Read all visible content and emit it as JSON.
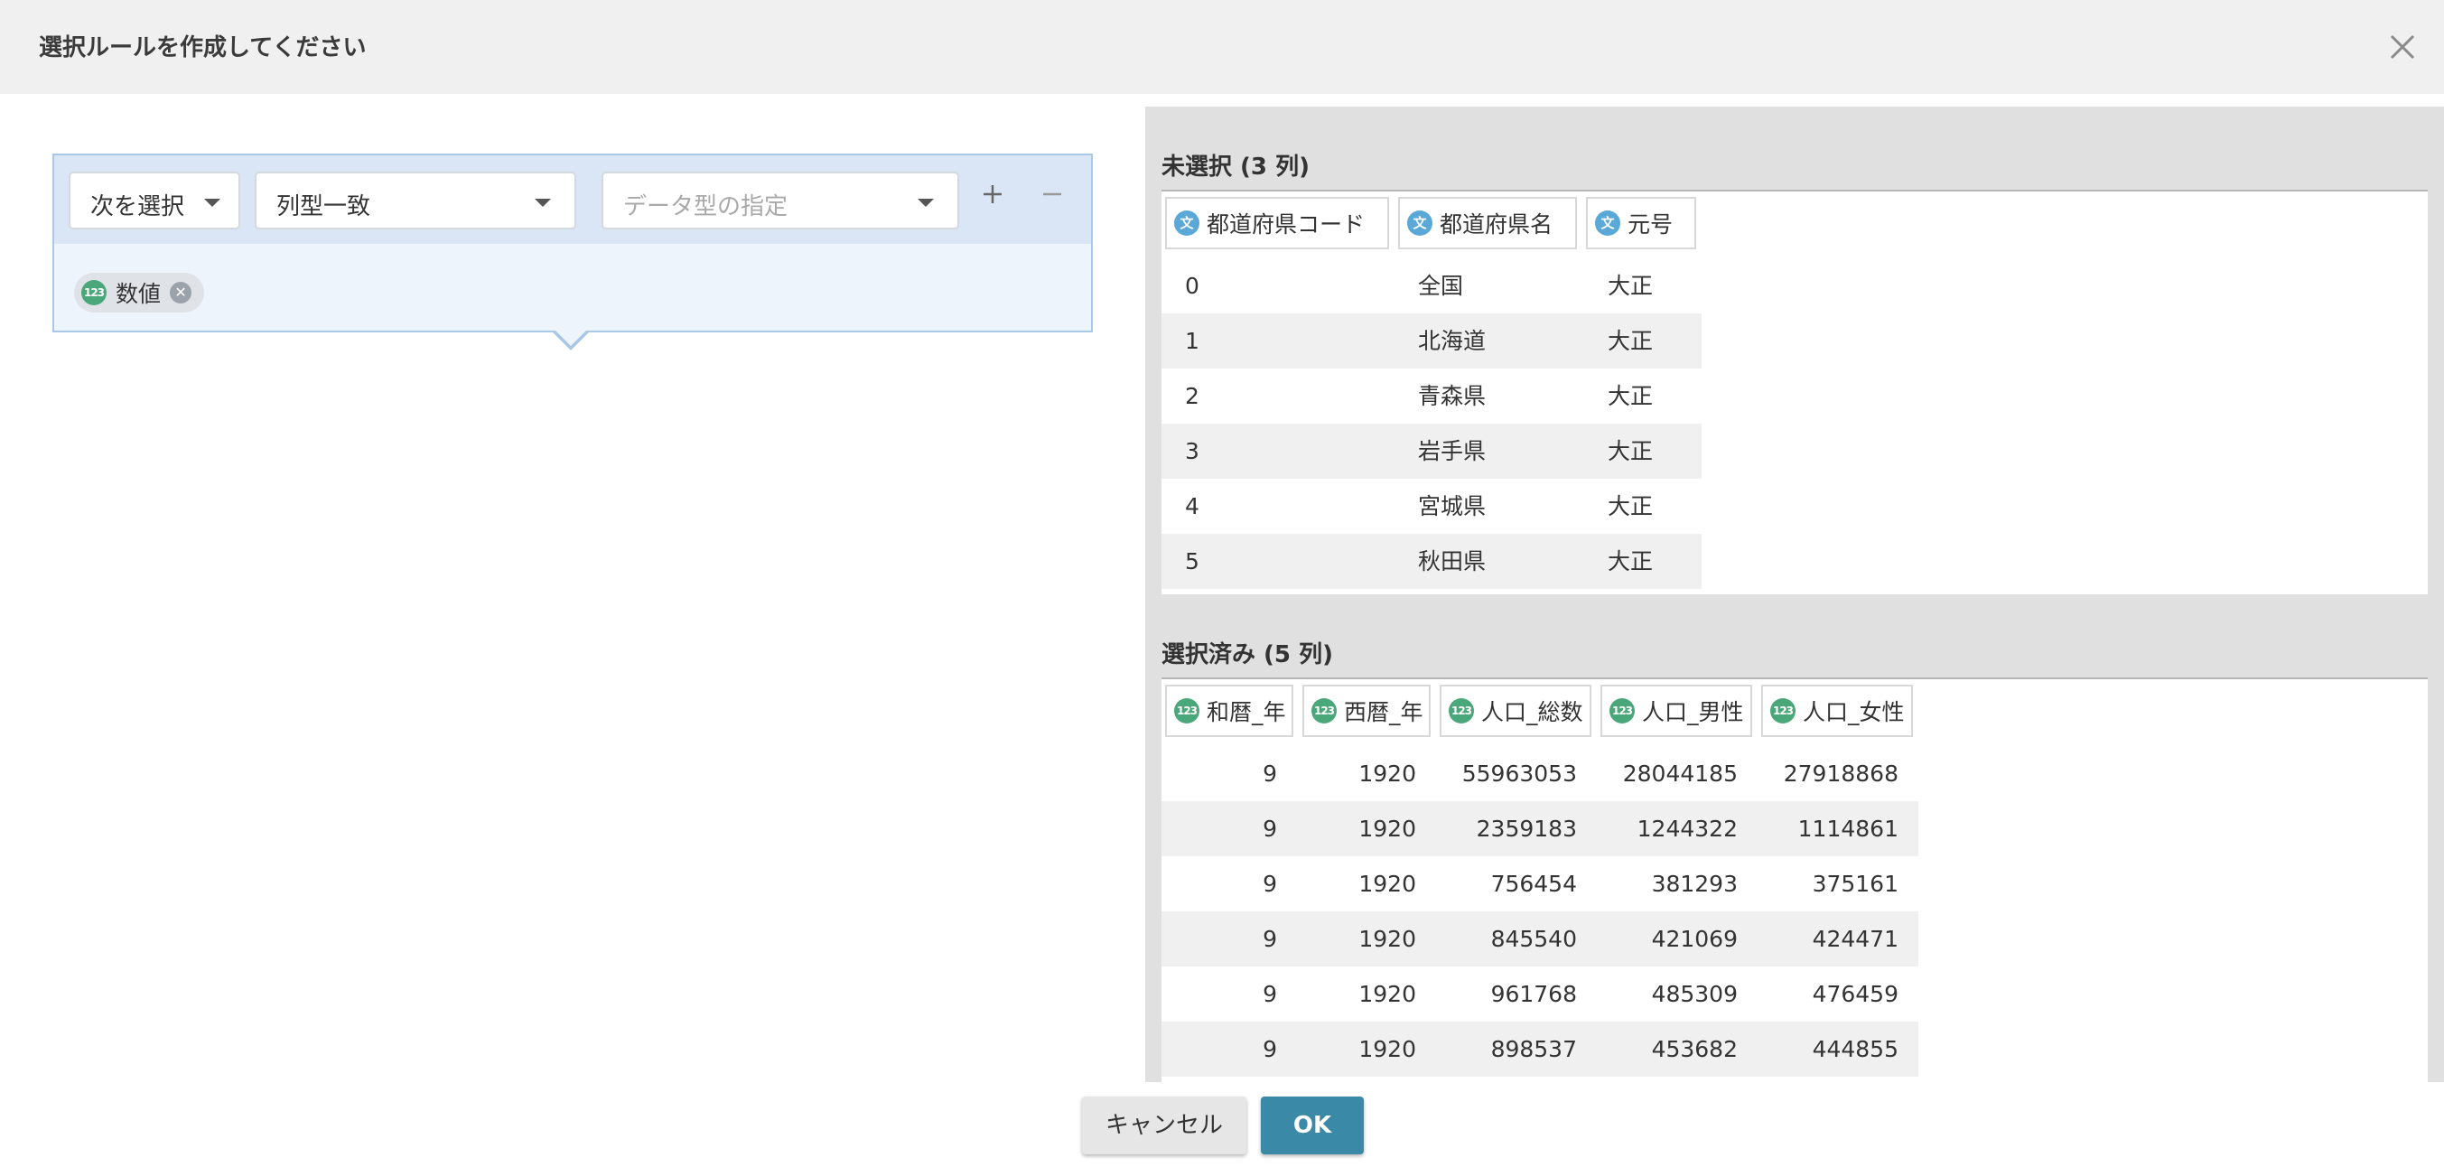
{
  "dialog": {
    "title": "選択ルールを作成してください"
  },
  "rule": {
    "mode_select": "次を選択",
    "match_select": "列型一致",
    "type_select_placeholder": "データ型の指定",
    "selected_type_chip": "数値"
  },
  "unselected": {
    "title": "未選択 (3 列)",
    "columns": [
      "都道府県コード",
      "都道府県名",
      "元号"
    ],
    "column_types": [
      "text",
      "text",
      "text"
    ],
    "rows": [
      [
        "0",
        "全国",
        "大正"
      ],
      [
        "1",
        "北海道",
        "大正"
      ],
      [
        "2",
        "青森県",
        "大正"
      ],
      [
        "3",
        "岩手県",
        "大正"
      ],
      [
        "4",
        "宮城県",
        "大正"
      ],
      [
        "5",
        "秋田県",
        "大正"
      ]
    ]
  },
  "selected": {
    "title": "選択済み (5 列)",
    "columns": [
      "和暦_年",
      "西暦_年",
      "人口_総数",
      "人口_男性",
      "人口_女性"
    ],
    "column_types": [
      "number",
      "number",
      "number",
      "number",
      "number"
    ],
    "rows": [
      [
        "9",
        "1920",
        "55963053",
        "28044185",
        "27918868"
      ],
      [
        "9",
        "1920",
        "2359183",
        "1244322",
        "1114861"
      ],
      [
        "9",
        "1920",
        "756454",
        "381293",
        "375161"
      ],
      [
        "9",
        "1920",
        "845540",
        "421069",
        "424471"
      ],
      [
        "9",
        "1920",
        "961768",
        "485309",
        "476459"
      ],
      [
        "9",
        "1920",
        "898537",
        "453682",
        "444855"
      ]
    ]
  },
  "type_icons": {
    "text": "文",
    "number": "123"
  },
  "footer": {
    "cancel_label": "キャンセル",
    "ok_label": "OK"
  },
  "colors": {
    "accent": "#3a89a6",
    "text_type": "#5aa8d8",
    "number_type": "#4aa77a",
    "rule_border": "#a9c8e6",
    "rule_toolbar": "#dae6f5"
  }
}
